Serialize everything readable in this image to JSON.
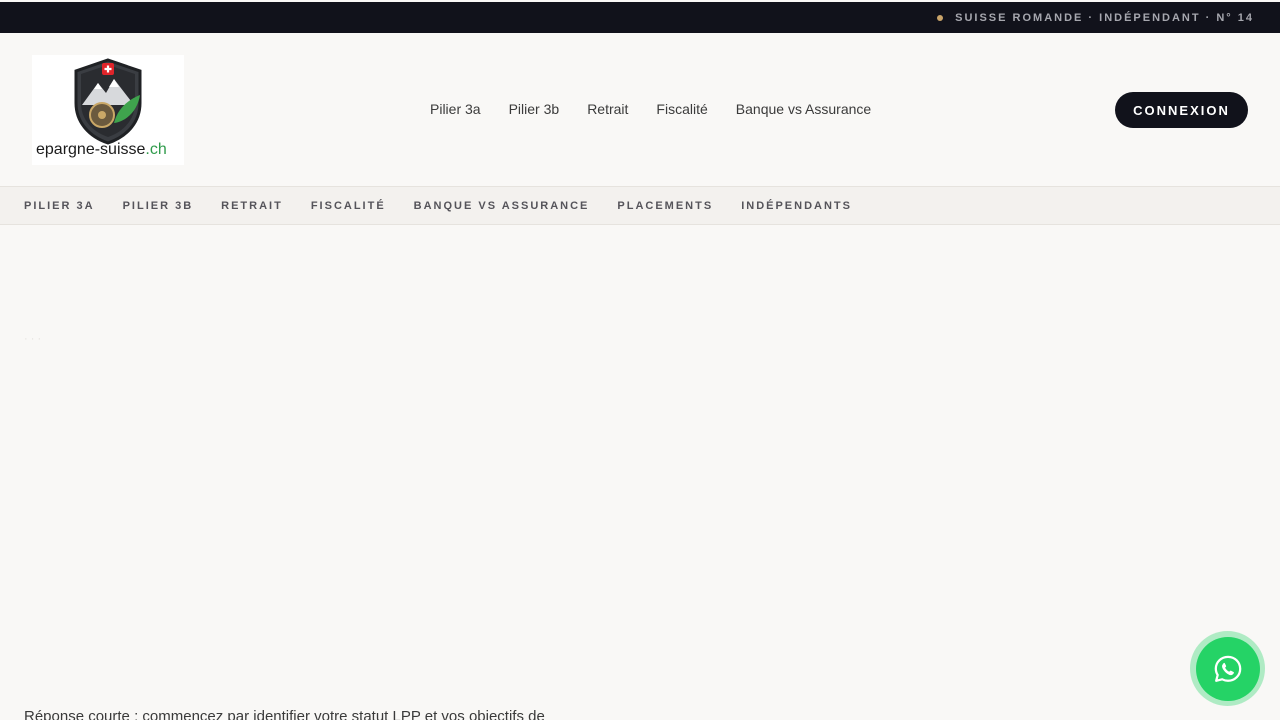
{
  "topbar": {
    "tagline": "SUISSE ROMANDE · INDÉPENDANT · N° 14",
    "dot_color": "#c9a46a"
  },
  "logo": {
    "name": "epargne-suisse",
    "tld": ".ch",
    "icon": "shield-mountain-logo"
  },
  "mainnav": {
    "items": [
      "Pilier 3a",
      "Pilier 3b",
      "Retrait",
      "Fiscalité",
      "Banque vs Assurance"
    ]
  },
  "login": {
    "label": "CONNEXION"
  },
  "subnav": {
    "items": [
      "PILIER 3A",
      "PILIER 3B",
      "RETRAIT",
      "FISCALITÉ",
      "BANQUE VS ASSURANCE",
      "PLACEMENTS",
      "INDÉPENDANTS"
    ]
  },
  "content": {
    "ghost": "· · ·",
    "answer": "Réponse courte : commencez par identifier votre statut LPP et vos objectifs de"
  },
  "whatsapp": {
    "icon": "whatsapp-icon",
    "color": "#25d366"
  },
  "colors": {
    "dark": "#11121b",
    "background": "#f9f8f6",
    "accent_green": "#2f9b4b"
  }
}
